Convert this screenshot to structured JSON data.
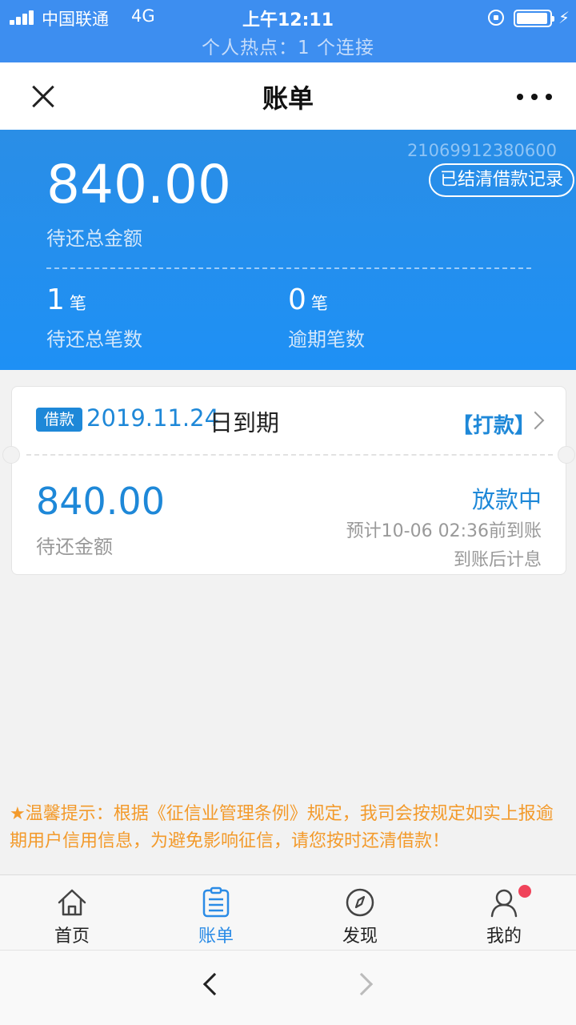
{
  "status_bar": {
    "carrier": "中国联通",
    "network": "4G",
    "time": "上午12:11",
    "hotspot": "个人热点：1 个连接"
  },
  "nav": {
    "title": "账单"
  },
  "summary": {
    "order_no": "21069912380600",
    "history_button": "已结清借款记录",
    "total_amount": "840.00",
    "total_label": "待还总金额",
    "pending_count": "1",
    "pending_unit": "笔",
    "pending_label": "待还总笔数",
    "overdue_count": "0",
    "overdue_unit": "笔",
    "overdue_label": "逾期笔数"
  },
  "bill_card": {
    "tag": "借款",
    "due_date": "2019.11.24",
    "due_suffix": "日到期",
    "pay_link": "【打款】",
    "amount": "840.00",
    "amount_label": "待还金额",
    "status": "放款中",
    "eta": "预计10-06 02:36前到账",
    "interest_note": "到账后计息"
  },
  "tip": {
    "star": "★",
    "text": "温馨提示：根据《征信业管理条例》规定，我司会按规定如实上报逾期用户信用信息，为避免影响征信，请您按时还清借款！"
  },
  "tabs": [
    {
      "label": "首页",
      "icon": "home-icon"
    },
    {
      "label": "账单",
      "icon": "bill-icon"
    },
    {
      "label": "发现",
      "icon": "compass-icon"
    },
    {
      "label": "我的",
      "icon": "user-icon"
    }
  ],
  "colors": {
    "brand_blue": "#1e90f5",
    "accent_blue": "#1e88d8",
    "tip_orange": "#f39a2b",
    "badge_red": "#f0435a"
  }
}
